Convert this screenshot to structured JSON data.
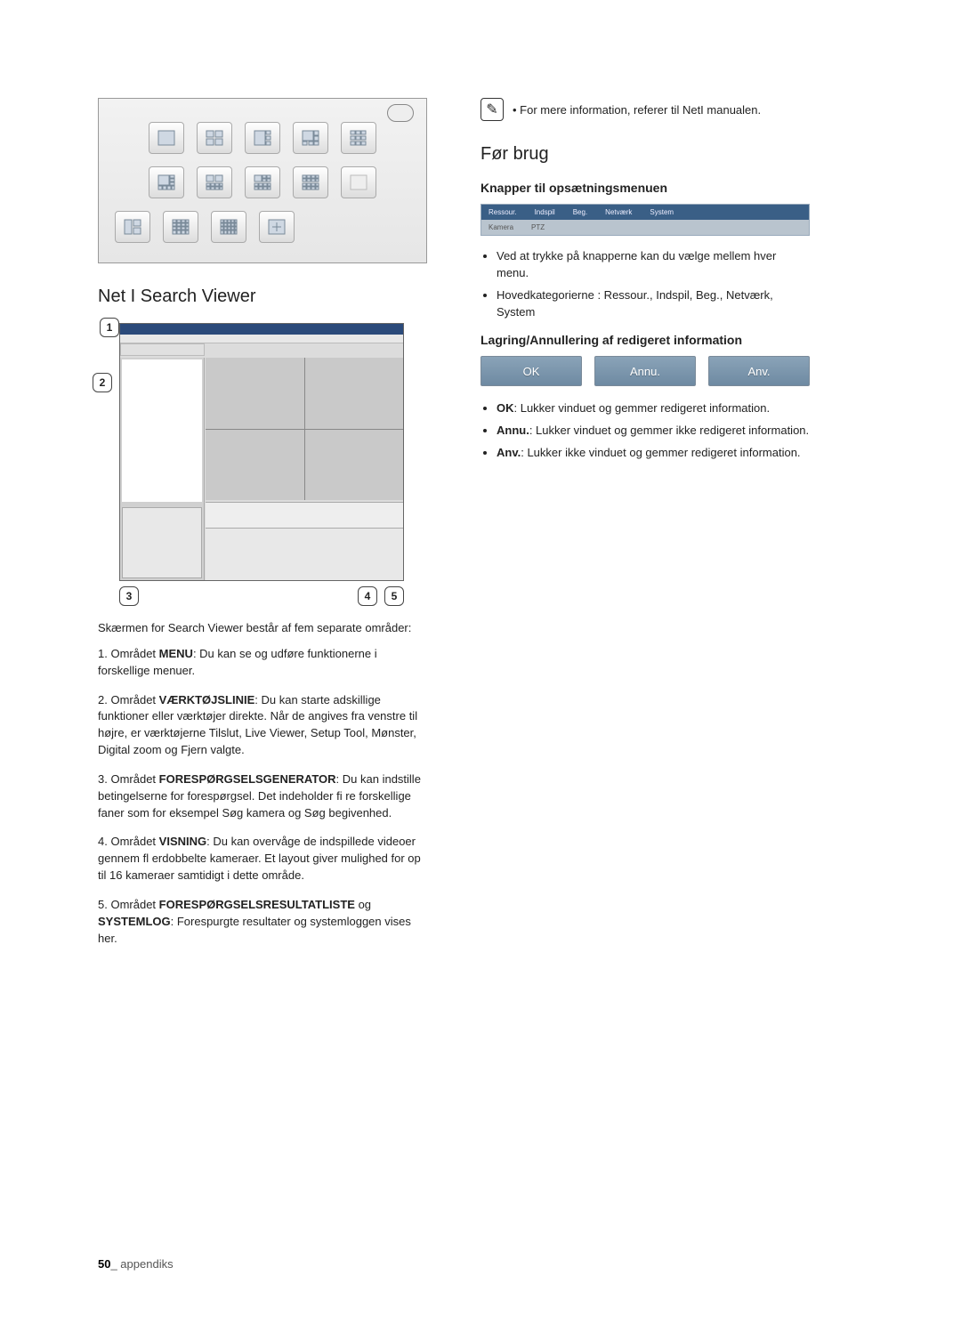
{
  "left": {
    "section_title": "Net I Search Viewer",
    "callouts": [
      "1",
      "2",
      "3",
      "4",
      "5"
    ],
    "intro": "Skærmen for Search Viewer består af fem separate områder:",
    "items": [
      {
        "n": "1.",
        "lead": "Området ",
        "bold": "MENU",
        "tail": ": Du kan se og udføre funktionerne i forskellige menuer."
      },
      {
        "n": "2.",
        "lead": "Området ",
        "bold": "VÆRKTØJSLINIE",
        "tail": ": Du kan starte adskillige funktioner eller værktøjer direkte. Når de angives fra venstre til højre, er værktøjerne Tilslut, Live Viewer, Setup Tool, Mønster, Digital zoom og Fjern valgte."
      },
      {
        "n": "3.",
        "lead": "Området ",
        "bold": "FORESPØRGSELSGENERATOR",
        "tail": ": Du kan indstille betingelserne for forespørgsel. Det indeholder fi re forskellige faner som for eksempel Søg kamera og Søg begivenhed."
      },
      {
        "n": "4.",
        "lead": "Området ",
        "bold": "VISNING",
        "tail": ": Du kan overvåge de indspillede videoer gennem fl erdobbelte kameraer. Et layout giver mulighed for op til 16 kameraer samtidigt i dette område."
      },
      {
        "n": "5.",
        "lead": "Området ",
        "bold": "FORESPØRGSELSRESULTATLISTE",
        "tail2_bold": "SYSTEMLOG",
        "mid": " og ",
        "tail": ": Forespurgte resultater og systemloggen vises her."
      }
    ]
  },
  "right": {
    "note": "For mere information, referer til NetI manualen.",
    "h_before": "Før brug",
    "h_buttons": "Knapper til opsætningsmenuen",
    "menu_top": [
      "Ressour.",
      "Indspil",
      "Beg.",
      "Netværk",
      "System"
    ],
    "menu_bot": [
      "Kamera",
      "PTZ"
    ],
    "bul1": [
      "Ved at trykke på knapperne kan du vælge mellem hver menu.",
      "Hovedkategorierne : Ressour., Indspil, Beg., Netværk, System"
    ],
    "h_save": "Lagring/Annullering af redigeret information",
    "btn_ok": "OK",
    "btn_annu": "Annu.",
    "btn_anv": "Anv.",
    "bul2": [
      {
        "b": "OK",
        "t": ":  Lukker vinduet og gemmer redigeret information."
      },
      {
        "b": "Annu.",
        "t": ": Lukker vinduet og gemmer ikke redigeret information."
      },
      {
        "b": "Anv.",
        "t": ": Lukker ikke vinduet og gemmer redigeret information."
      }
    ]
  },
  "footer": {
    "page": "50",
    "label": "_ appendiks"
  }
}
